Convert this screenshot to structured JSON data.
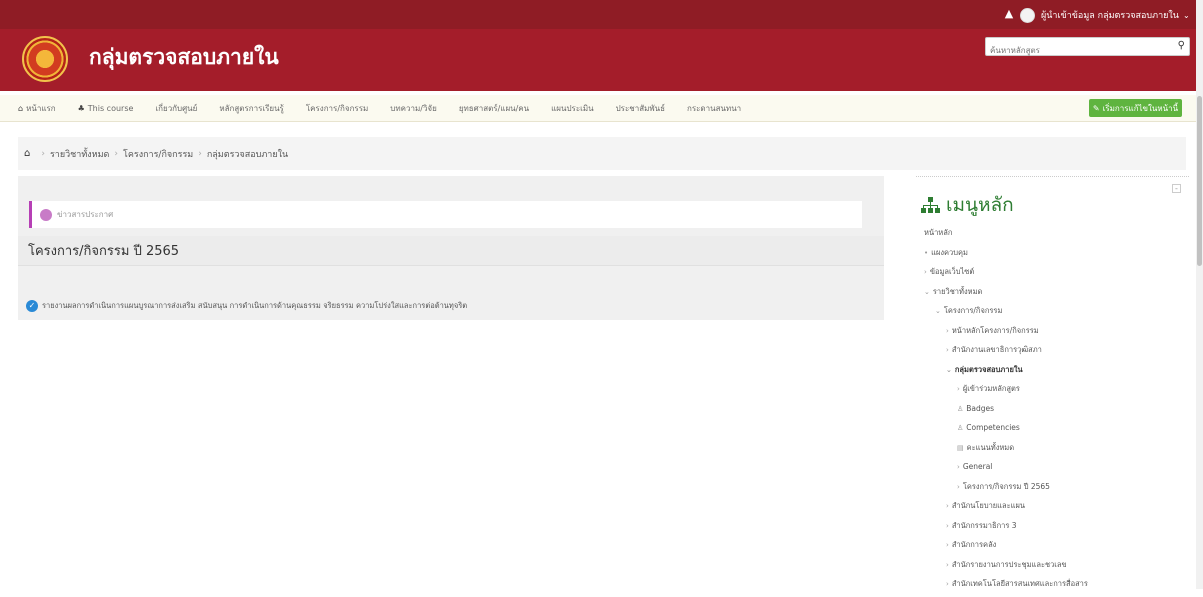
{
  "topbar": {
    "bell_icon": "bell-icon",
    "user_name": "ผู้นำเข้าข้อมูล กลุ่มตรวจสอบภายใน",
    "caret": "⌄"
  },
  "header": {
    "site_name": "กลุ่มตรวจสอบภายใน",
    "search": {
      "placeholder": "ค้นหาหลักสูตร",
      "icon": "search-icon"
    }
  },
  "nav": {
    "items": [
      {
        "label": "หน้าแรก",
        "icon": "home-icon"
      },
      {
        "label": "This course",
        "icon": "sitemap-icon"
      },
      {
        "label": "เกี่ยวกับศูนย์"
      },
      {
        "label": "หลักสูตรการเรียนรู้"
      },
      {
        "label": "โครงการ/กิจกรรม"
      },
      {
        "label": "บทความ/วิจัย"
      },
      {
        "label": "ยุทธศาสตร์/แผน/คน"
      },
      {
        "label": "แผนประเมิน"
      },
      {
        "label": "ประชาสัมพันธ์"
      },
      {
        "label": "กระดานสนทนา"
      }
    ],
    "start_button": "เริ่มการแก้ไขในหน้านี้"
  },
  "breadcrumb": {
    "items": [
      "รายวิชาทั้งหมด",
      "โครงการ/กิจกรรม",
      "กลุ่มตรวจสอบภายใน"
    ]
  },
  "main": {
    "news_label": "ข่าวสารประกาศ",
    "section_title": "โครงการ/กิจกรรม ปี 2565",
    "item_text": "รายงานผลการดำเนินการแผนบูรณาการส่งเสริม สนับสนุน การดำเนินการด้านคุณธรรม จริยธรรม ความโปร่งใสและการต่อต้านทุจริต"
  },
  "right_menu": {
    "title": "เมนูหลัก",
    "items": [
      {
        "label": "หน้าหลัก",
        "indent": 0,
        "icon": ""
      },
      {
        "label": "แผงควบคุม",
        "indent": 0,
        "icon": "•"
      },
      {
        "label": "ข้อมูลเว็บไซต์",
        "indent": 0,
        "icon": "›"
      },
      {
        "label": "รายวิชาทั้งหมด",
        "indent": 0,
        "icon": "⌄"
      },
      {
        "label": "โครงการ/กิจกรรม",
        "indent": 1,
        "icon": "⌄"
      },
      {
        "label": "หน้าหลักโครงการ/กิจกรรม",
        "indent": 2,
        "icon": "›"
      },
      {
        "label": "สำนักงานเลขาธิการวุฒิสภา",
        "indent": 2,
        "icon": "›"
      },
      {
        "label": "กลุ่มตรวจสอบภายใน",
        "indent": 2,
        "icon": "⌄",
        "bold": true
      },
      {
        "label": "ผู้เข้าร่วมหลักสูตร",
        "indent": 3,
        "icon": "›"
      },
      {
        "label": "Badges",
        "indent": 3,
        "icon": "♙"
      },
      {
        "label": "Competencies",
        "indent": 3,
        "icon": "♙"
      },
      {
        "label": "คะแนนทั้งหมด",
        "indent": 3,
        "icon": "▤"
      },
      {
        "label": "General",
        "indent": 3,
        "icon": "›"
      },
      {
        "label": "โครงการ/กิจกรรม ปี 2565",
        "indent": 3,
        "icon": "›"
      },
      {
        "label": "สำนักนโยบายและแผน",
        "indent": 2,
        "icon": "›"
      },
      {
        "label": "สำนักกรรมาธิการ 3",
        "indent": 2,
        "icon": "›"
      },
      {
        "label": "สำนักการคลัง",
        "indent": 2,
        "icon": "›"
      },
      {
        "label": "สำนักรายงานการประชุมและชวเลข",
        "indent": 2,
        "icon": "›"
      },
      {
        "label": "สำนักเทคโนโลยีสารสนเทศและการสื่อสาร",
        "indent": 2,
        "icon": "›"
      }
    ]
  },
  "colors": {
    "topbar": "#8f1c25",
    "header": "#a41d2a",
    "accent_green": "#5fb43f",
    "menu_title": "#2e7d32"
  }
}
